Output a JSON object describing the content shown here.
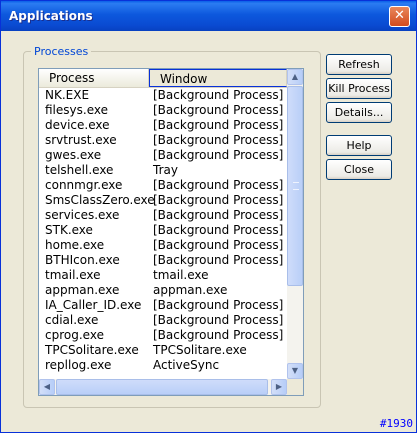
{
  "window": {
    "title": "Applications",
    "close_glyph": "✕"
  },
  "group": {
    "label": "Processes"
  },
  "list": {
    "columns": [
      "Process",
      "Window"
    ],
    "rows": [
      [
        "NK.EXE",
        "[Background Process]"
      ],
      [
        "filesys.exe",
        "[Background Process]"
      ],
      [
        "device.exe",
        "[Background Process]"
      ],
      [
        "srvtrust.exe",
        "[Background Process]"
      ],
      [
        "gwes.exe",
        "[Background Process]"
      ],
      [
        "telshell.exe",
        "Tray"
      ],
      [
        "connmgr.exe",
        "[Background Process]"
      ],
      [
        "SmsClassZero.exe",
        "[Background Process]"
      ],
      [
        "services.exe",
        "[Background Process]"
      ],
      [
        "STK.exe",
        "[Background Process]"
      ],
      [
        "home.exe",
        "[Background Process]"
      ],
      [
        "BTHIcon.exe",
        "[Background Process]"
      ],
      [
        "tmail.exe",
        "tmail.exe"
      ],
      [
        "appman.exe",
        "appman.exe"
      ],
      [
        "IA_Caller_ID.exe",
        "[Background Process]"
      ],
      [
        "cdial.exe",
        "[Background Process]"
      ],
      [
        "cprog.exe",
        "[Background Process]"
      ],
      [
        "TPCSolitare.exe",
        "TPCSolitare.exe"
      ],
      [
        "repllog.exe",
        "ActiveSync"
      ]
    ]
  },
  "buttons": {
    "refresh": "Refresh",
    "kill": "Kill Process",
    "details": "Details...",
    "help": "Help",
    "close": "Close"
  },
  "watermark": "#1930"
}
